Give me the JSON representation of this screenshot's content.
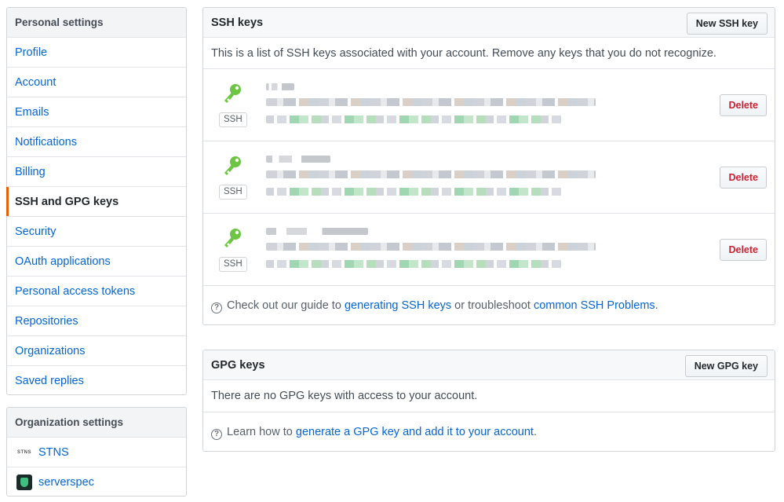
{
  "personal_settings": {
    "heading": "Personal settings",
    "items": [
      {
        "label": "Profile"
      },
      {
        "label": "Account"
      },
      {
        "label": "Emails"
      },
      {
        "label": "Notifications"
      },
      {
        "label": "Billing"
      },
      {
        "label": "SSH and GPG keys",
        "selected": true
      },
      {
        "label": "Security"
      },
      {
        "label": "OAuth applications"
      },
      {
        "label": "Personal access tokens"
      },
      {
        "label": "Repositories"
      },
      {
        "label": "Organizations"
      },
      {
        "label": "Saved replies"
      }
    ]
  },
  "organization_settings": {
    "heading": "Organization settings",
    "items": [
      {
        "label": "STNS",
        "avatar_text": "STNS"
      },
      {
        "label": "serverspec"
      }
    ]
  },
  "ssh": {
    "title": "SSH keys",
    "new_button": "New SSH key",
    "description": "This is a list of SSH keys associated with your account. Remove any keys that you do not recognize.",
    "keys": [
      {
        "badge": "SSH",
        "delete_label": "Delete"
      },
      {
        "badge": "SSH",
        "delete_label": "Delete"
      },
      {
        "badge": "SSH",
        "delete_label": "Delete"
      }
    ],
    "help": {
      "prefix": "Check out our guide to ",
      "link1": "generating SSH keys",
      "middle": " or troubleshoot ",
      "link2": "common SSH Problems",
      "suffix": "."
    }
  },
  "gpg": {
    "title": "GPG keys",
    "new_button": "New GPG key",
    "empty_text": "There are no GPG keys with access to your account.",
    "help": {
      "prefix": "Learn how to ",
      "link": "generate a GPG key and add it to your account",
      "suffix": "."
    }
  },
  "colors": {
    "link": "#0366d6",
    "selected_accent": "#e36209",
    "key_icon": "#6cc644",
    "danger": "#cb2431"
  }
}
